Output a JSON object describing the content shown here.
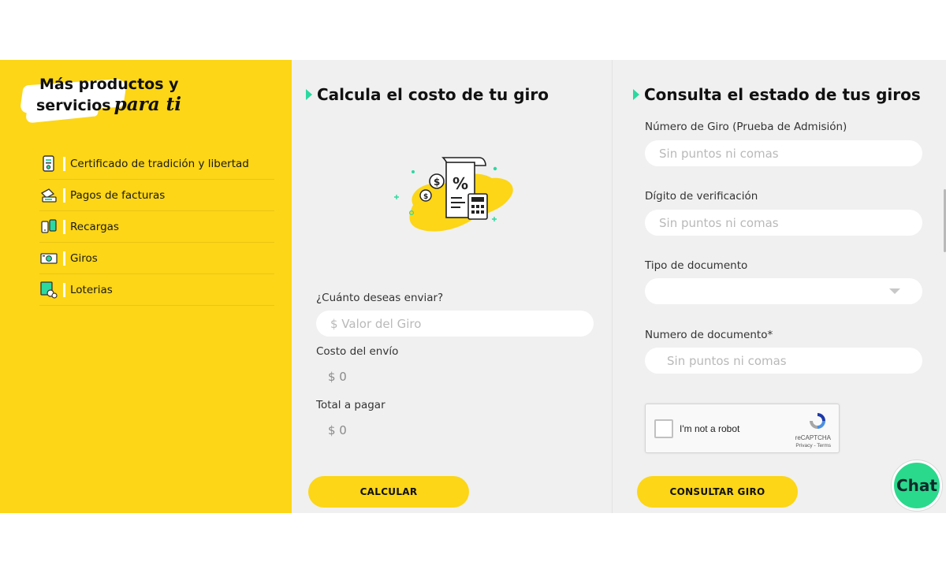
{
  "sidebar": {
    "title_line1": "Más productos y",
    "title_line2": "servicios",
    "title_script": "para ti",
    "items": [
      {
        "label": "Certificado de tradición y libertad",
        "icon": "certificate-icon"
      },
      {
        "label": "Pagos de facturas",
        "icon": "bill-payment-icon"
      },
      {
        "label": "Recargas",
        "icon": "phone-recharge-icon"
      },
      {
        "label": "Giros",
        "icon": "money-transfer-icon"
      },
      {
        "label": "Loterias",
        "icon": "lottery-icon"
      }
    ]
  },
  "calc": {
    "title": "Calcula el costo de tu giro",
    "illustration": "calculator-receipt-illustration",
    "send_label": "¿Cuánto deseas enviar?",
    "send_placeholder": "$ Valor del Giro",
    "cost_label": "Costo del envío",
    "cost_value": "$ 0",
    "total_label": "Total a pagar",
    "total_value": "$ 0",
    "button": "CALCULAR"
  },
  "consulta": {
    "title": "Consulta el estado de tus giros",
    "giro_label": "Número de Giro (Prueba de Admisión)",
    "giro_placeholder": "Sin puntos ni comas",
    "digit_label": "Dígito de verificación",
    "digit_placeholder": "Sin puntos ni comas",
    "doctype_label": "Tipo de documento",
    "doctype_value": "",
    "docnum_label": "Numero de documento*",
    "docnum_placeholder": "Sin puntos ni comas",
    "captcha_text": "I'm not a robot",
    "captcha_brand": "reCAPTCHA",
    "captcha_links": "Privacy - Terms",
    "button": "CONSULTAR GIRO"
  },
  "chat": {
    "label": "Chat"
  },
  "colors": {
    "brand_yellow": "#fcd617",
    "accent_green": "#2bd9a0",
    "panel_gray": "#f0f0f0"
  }
}
